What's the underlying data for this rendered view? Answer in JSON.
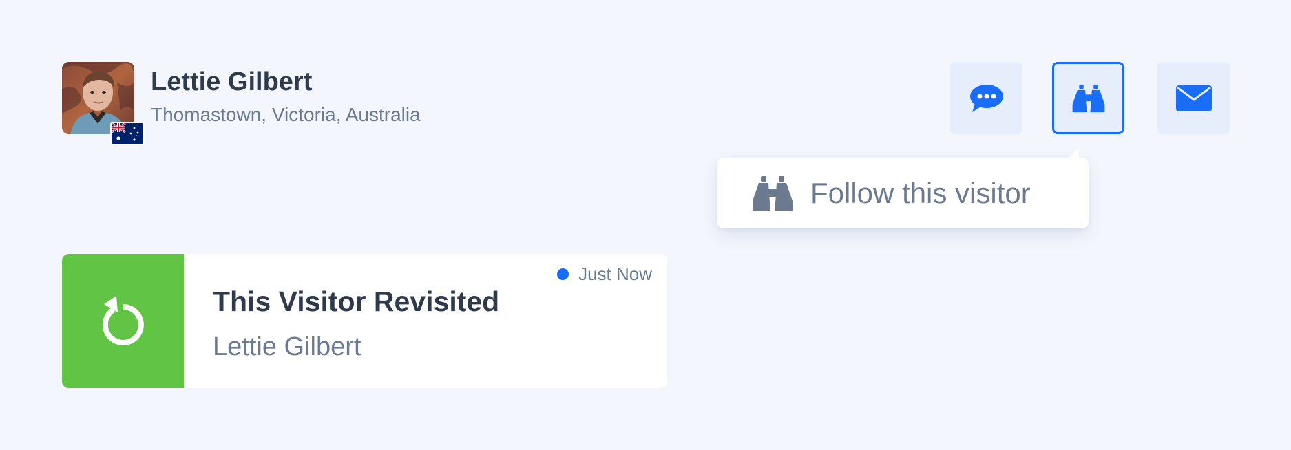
{
  "profile": {
    "name": "Lettie Gilbert",
    "location": "Thomastown, Victoria, Australia",
    "avatar_icon": "user-photo",
    "flag_icon": "australia-flag"
  },
  "actions": {
    "chat_icon": "chat-bubble-icon",
    "follow_icon": "binoculars-icon",
    "mail_icon": "envelope-icon",
    "active": "follow"
  },
  "tooltip": {
    "text": "Follow this visitor",
    "icon": "binoculars-icon"
  },
  "activity_card": {
    "title": "This Visitor Revisited",
    "subtitle": "Lettie Gilbert",
    "time": "Just Now",
    "icon": "revisit-arrow-icon"
  },
  "colors": {
    "background": "#f3f6fd",
    "accent_blue": "#1a6ef5",
    "button_bg": "#e6eefc",
    "card_accent_green": "#62c444",
    "text_dark": "#2f3a4a",
    "text_muted": "#6b7a8f"
  }
}
